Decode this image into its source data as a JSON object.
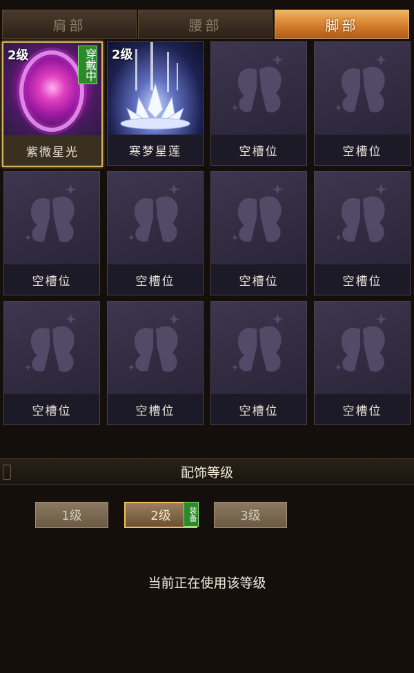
{
  "tabs": [
    {
      "label": "肩部",
      "active": false
    },
    {
      "label": "腰部",
      "active": false
    },
    {
      "label": "脚部",
      "active": true
    }
  ],
  "slots": [
    {
      "name": "紫微星光",
      "level": "2级",
      "badge": "穿戴中",
      "icon": "purple-orb-icon",
      "selected": true
    },
    {
      "name": "寒梦星莲",
      "level": "2级",
      "icon": "white-lotus-icon"
    },
    {
      "name": "空槽位",
      "icon": "butterfly-placeholder-icon"
    },
    {
      "name": "空槽位",
      "icon": "butterfly-placeholder-icon"
    },
    {
      "name": "空槽位",
      "icon": "butterfly-placeholder-icon"
    },
    {
      "name": "空槽位",
      "icon": "butterfly-placeholder-icon"
    },
    {
      "name": "空槽位",
      "icon": "butterfly-placeholder-icon"
    },
    {
      "name": "空槽位",
      "icon": "butterfly-placeholder-icon"
    },
    {
      "name": "空槽位",
      "icon": "butterfly-placeholder-icon"
    },
    {
      "name": "空槽位",
      "icon": "butterfly-placeholder-icon"
    },
    {
      "name": "空槽位",
      "icon": "butterfly-placeholder-icon"
    },
    {
      "name": "空槽位",
      "icon": "butterfly-placeholder-icon"
    }
  ],
  "section": {
    "title": "配饰等级"
  },
  "levels": [
    {
      "label": "1级",
      "active": false
    },
    {
      "label": "2级",
      "active": true,
      "badge": "装备"
    },
    {
      "label": "3级",
      "active": false
    }
  ],
  "status_text": "当前正在使用该等级",
  "colors": {
    "accent": "#d0792a",
    "equipped": "#2c8a2a",
    "selected_border": "#d8b060"
  }
}
